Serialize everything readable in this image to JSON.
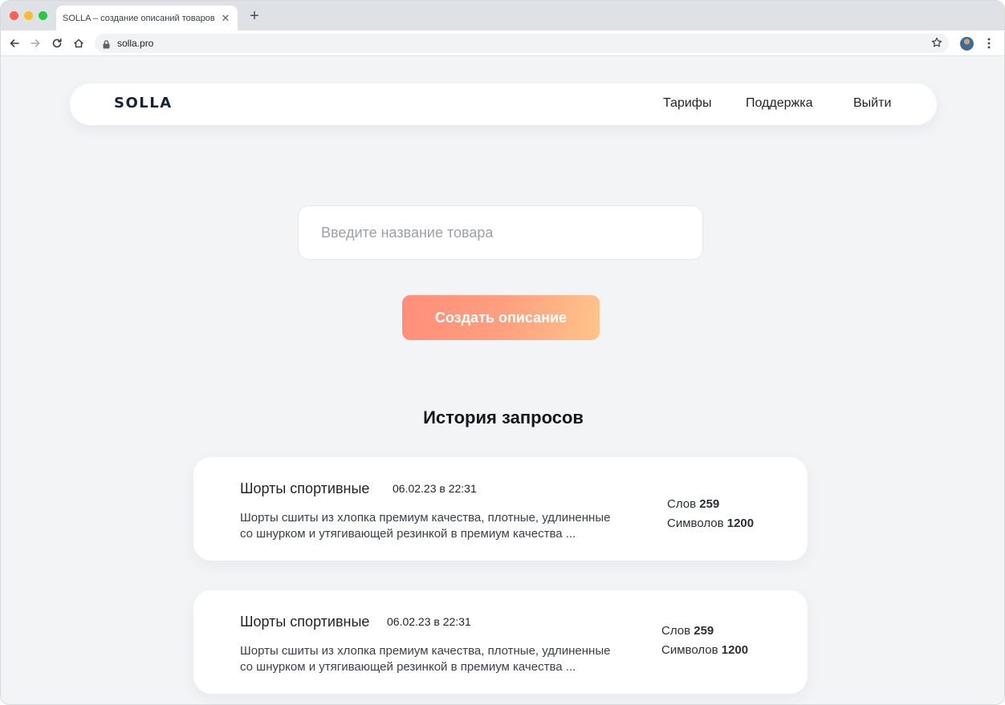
{
  "browser": {
    "tab_title": "SOLLA – создание описаний товаров",
    "url": "solla.pro"
  },
  "header": {
    "logo": "SOLLA",
    "nav": [
      "Тарифы",
      "Поддержка",
      "Выйти"
    ]
  },
  "search": {
    "placeholder": "Введите название товара",
    "value": ""
  },
  "create_button": "Создать описание",
  "history": {
    "title": "История запросов",
    "items": [
      {
        "title": "Шорты спортивные",
        "date": "06.02.23 в 22:31",
        "text_line1": "Шорты сшиты из хлопка премиум качества, плотные, удлиненные",
        "text_line2": "со шнурком и утягивающей резинкой в премиум качества ...",
        "words_label": "Слов",
        "words_value": "259",
        "chars_label": "Символов",
        "chars_value": "1200"
      },
      {
        "title": "Шорты спортивные",
        "date": "06.02.23 в 22:31",
        "text_line1": "Шорты сшиты из хлопка премиум качества, плотные, удлиненные",
        "text_line2": "со шнурком и утягивающей резинкой в премиум качества ...",
        "words_label": "Слов",
        "words_value": "259",
        "chars_label": "Символов",
        "chars_value": "1200"
      }
    ]
  },
  "colors": {
    "button_gradient_start": "#ff8e7a",
    "button_gradient_end": "#ffc48a",
    "logo": "#15233a",
    "page_background": "#f3f4f6"
  }
}
